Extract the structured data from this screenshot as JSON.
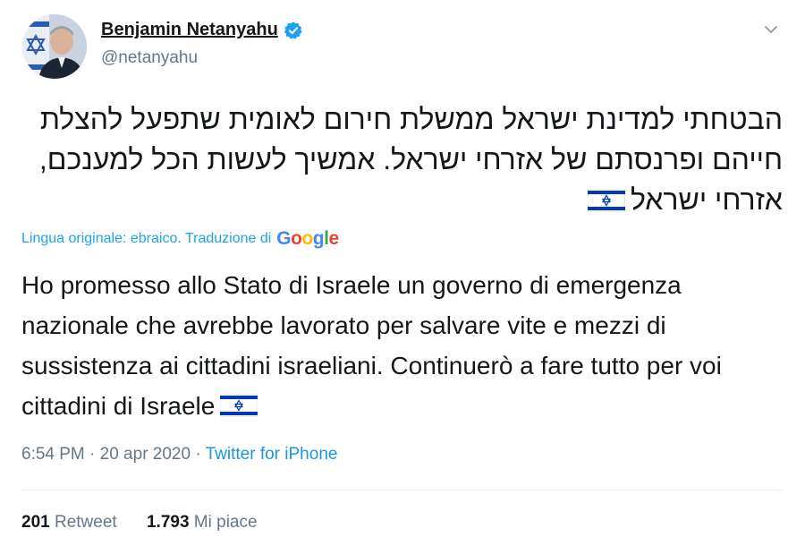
{
  "tweet": {
    "author": {
      "name": "Benjamin Netanyahu",
      "handle": "@netanyahu",
      "verified": true
    },
    "original_text": "הבטחתי למדינת ישראל ממשלת חירום לאומית שתפעל להצלת חייהם ופרנסתם של אזרחי ישראל. אמשיך לעשות הכל למענכם, אזרחי ישראל",
    "original_emoji": "israel-flag",
    "translation_label": "Lingua originale: ebraico. Traduzione di",
    "translation_provider": "Google",
    "translated_text": "Ho promesso allo Stato di Israele un governo di emergenza nazionale che avrebbe lavorato per salvare vite e mezzi di sussistenza ai cittadini israeliani. Continuerò a fare tutto per voi cittadini di Israele",
    "translated_emoji": "israel-flag",
    "timestamp": "6:54 PM · 20 apr 2020 · ",
    "source": "Twitter for iPhone",
    "stats": {
      "retweets_count": "201",
      "retweets_label": "Retweet",
      "likes_count": "1.793",
      "likes_label": "Mi piace"
    }
  },
  "colors": {
    "text": "#14171a",
    "secondary": "#657786",
    "link": "#1da1f2",
    "verified": "#1da1f2",
    "flag_blue": "#0038b8",
    "divider": "#e6ecf0"
  }
}
